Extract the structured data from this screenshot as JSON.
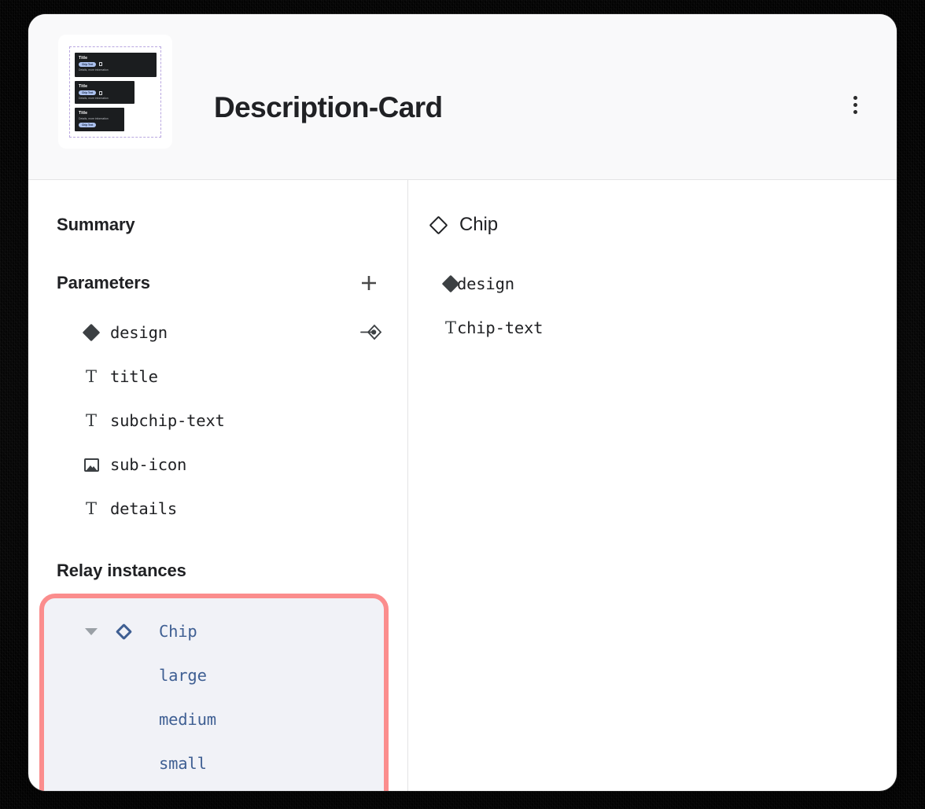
{
  "header": {
    "title": "Description-Card",
    "kebab_icon": "more-vertical-icon",
    "thumbnail": {
      "alt": "description-card-preview",
      "cards": [
        {
          "title": "Title",
          "chip": "Chip Text",
          "icon": "bookmark-icon",
          "details": "Details, more information",
          "size": "lg"
        },
        {
          "title": "Title",
          "chip": "Chip Text",
          "icon": "bookmark-icon",
          "details": "Details, more information",
          "size": "md"
        },
        {
          "title": "Title",
          "chip": "Chip Text",
          "icon": "",
          "details": "Details, more information",
          "size": "sm"
        }
      ]
    }
  },
  "left_pane": {
    "summary_label": "Summary",
    "parameters_label": "Parameters",
    "add_icon": "plus-icon",
    "parameters": [
      {
        "name": "design",
        "icon": "diamond-filled-icon",
        "action_icon": "swap-instance-icon"
      },
      {
        "name": "title",
        "icon": "text-icon",
        "action_icon": ""
      },
      {
        "name": "subchip-text",
        "icon": "text-icon",
        "action_icon": ""
      },
      {
        "name": "sub-icon",
        "icon": "image-icon",
        "action_icon": ""
      },
      {
        "name": "details",
        "icon": "text-icon",
        "action_icon": ""
      }
    ],
    "relay_instances_label": "Relay instances",
    "relay_instances": [
      {
        "name": "Chip",
        "icon": "diamond-outline-icon",
        "caret": "caret-down-icon",
        "level": 0
      },
      {
        "name": "large",
        "icon": "",
        "caret": "",
        "level": 1
      },
      {
        "name": "medium",
        "icon": "",
        "caret": "",
        "level": 1
      },
      {
        "name": "small",
        "icon": "",
        "caret": "",
        "level": 1
      }
    ]
  },
  "right_pane": {
    "title": "Chip",
    "title_icon": "diamond-outline-icon",
    "items": [
      {
        "name": "design",
        "icon": "diamond-filled-icon"
      },
      {
        "name": "chip-text",
        "icon": "text-icon"
      }
    ]
  },
  "colors": {
    "highlight_border": "#fb8d8d",
    "highlight_fill": "#f1f2f7",
    "accent_blue": "#3f5f93",
    "text_primary": "#1f2023",
    "header_bg": "#f9f9fa",
    "divider": "#e3e3e5"
  }
}
